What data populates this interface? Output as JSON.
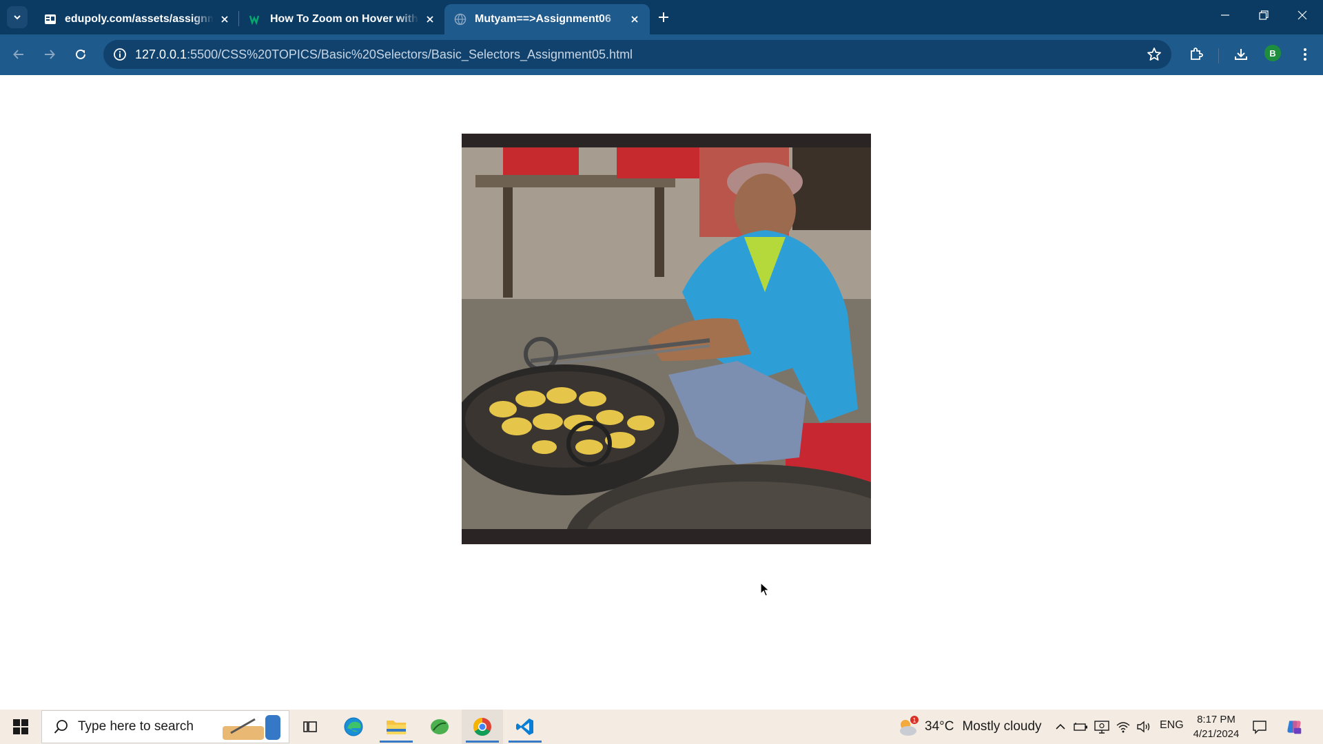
{
  "browser": {
    "tabs": [
      {
        "title": "edupoly.com/assets/assignments",
        "favicon": "edupoly-icon",
        "active": false
      },
      {
        "title": "How To Zoom on Hover with CSS",
        "favicon": "w3schools-icon",
        "active": false
      },
      {
        "title": "Mutyam==>Assignment06",
        "favicon": "globe-icon",
        "active": true
      }
    ],
    "address": {
      "host": "127.0.0.1",
      "path": ":5500/CSS%20TOPICS/Basic%20Selectors/Basic_Selectors_Assignment05.html"
    },
    "profile_initial": "B"
  },
  "page": {
    "image": {
      "description_icon": "photo"
    }
  },
  "taskbar": {
    "search_placeholder": "Type here to search",
    "weather": {
      "temp": "34°C",
      "condition": "Mostly cloudy",
      "alert_count": "1"
    },
    "language": "ENG",
    "time": "8:17 PM",
    "date": "4/21/2024"
  },
  "colors": {
    "tabstrip": "#0b3a63",
    "toolbar": "#1f5a8c",
    "taskbar": "#f4ece2"
  }
}
